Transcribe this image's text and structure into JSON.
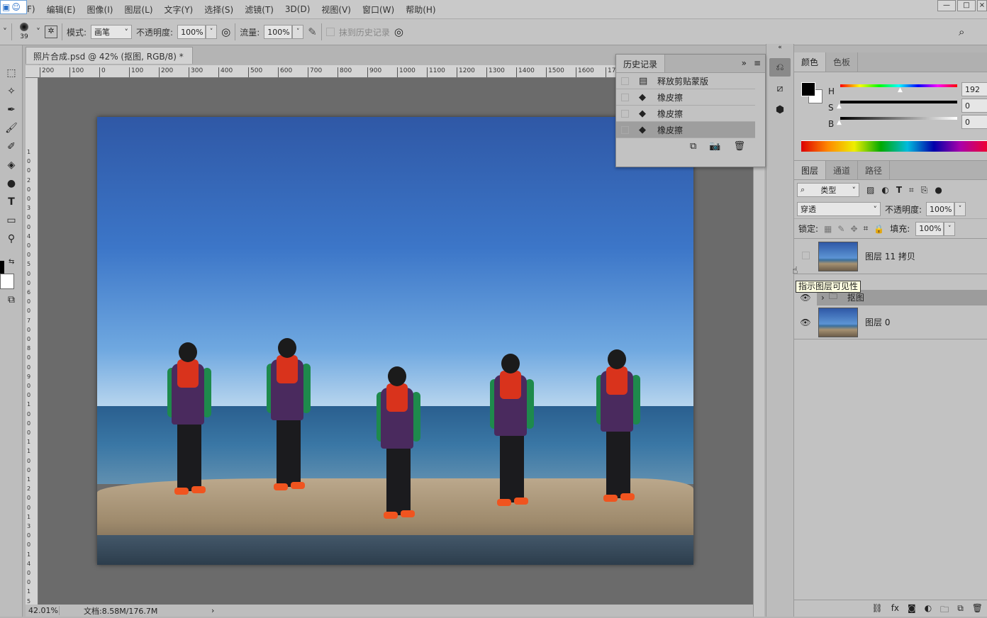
{
  "menu": [
    "F)",
    "编辑(E)",
    "图像(I)",
    "图层(L)",
    "文字(Y)",
    "选择(S)",
    "滤镜(T)",
    "3D(D)",
    "视图(V)",
    "窗口(W)",
    "帮助(H)"
  ],
  "options": {
    "brush_size": "39",
    "mode_label": "模式:",
    "mode_value": "画笔",
    "opacity_label": "不透明度:",
    "opacity_value": "100%",
    "flow_label": "流量:",
    "flow_value": "100%",
    "erase_history": "抹到历史记录"
  },
  "document": {
    "tab_title": "照片合成.psd @ 42% (抠图, RGB/8) *",
    "close": "×",
    "zoom": "42.01%",
    "doc_info": "文档:8.58M/176.7M"
  },
  "ruler_top": [
    "200",
    "100",
    "0",
    "100",
    "200",
    "300",
    "400",
    "500",
    "600",
    "700",
    "800",
    "900",
    "1000",
    "1100",
    "1200",
    "1300",
    "1400",
    "1500",
    "1600",
    "17"
  ],
  "ruler_left": [
    "1",
    "0",
    "0",
    "2",
    "0",
    "0",
    "3",
    "0",
    "0",
    "4",
    "0",
    "0",
    "5",
    "0",
    "0",
    "6",
    "0",
    "0",
    "7",
    "0",
    "0",
    "8",
    "0",
    "0",
    "9",
    "0",
    "0",
    "1",
    "0",
    "0",
    "0",
    "1",
    "1",
    "0",
    "0",
    "1",
    "2",
    "0",
    "0",
    "1",
    "3",
    "0",
    "0",
    "1",
    "4",
    "0",
    "0",
    "1",
    "5",
    "0",
    "0"
  ],
  "history": {
    "title": "历史记录",
    "items": [
      {
        "label": "释放剪贴蒙版",
        "icon": "document-icon"
      },
      {
        "label": "橡皮擦",
        "icon": "eraser-icon"
      },
      {
        "label": "橡皮擦",
        "icon": "eraser-icon"
      },
      {
        "label": "橡皮擦",
        "icon": "eraser-icon",
        "selected": true
      }
    ]
  },
  "color_panel": {
    "tabs": [
      "颜色",
      "色板"
    ],
    "h_label": "H",
    "s_label": "S",
    "b_label": "B",
    "h": "192",
    "s": "0",
    "b": "0",
    "foreground": "#000000",
    "background": "#ffffff"
  },
  "layers_panel": {
    "tabs": [
      "图层",
      "通道",
      "路径"
    ],
    "filter": "类型",
    "blend": "穿透",
    "opacity_label": "不透明度:",
    "opacity": "100%",
    "lock_label": "锁定:",
    "fill_label": "填充:",
    "fill": "100%",
    "layers": [
      {
        "name": "图层 11 拷贝",
        "visible": false
      },
      {
        "name": "抠图",
        "group": true,
        "visible": true,
        "selected": true
      },
      {
        "name": "图层 0",
        "visible": true
      }
    ]
  },
  "tooltip": "指示图层可见性"
}
